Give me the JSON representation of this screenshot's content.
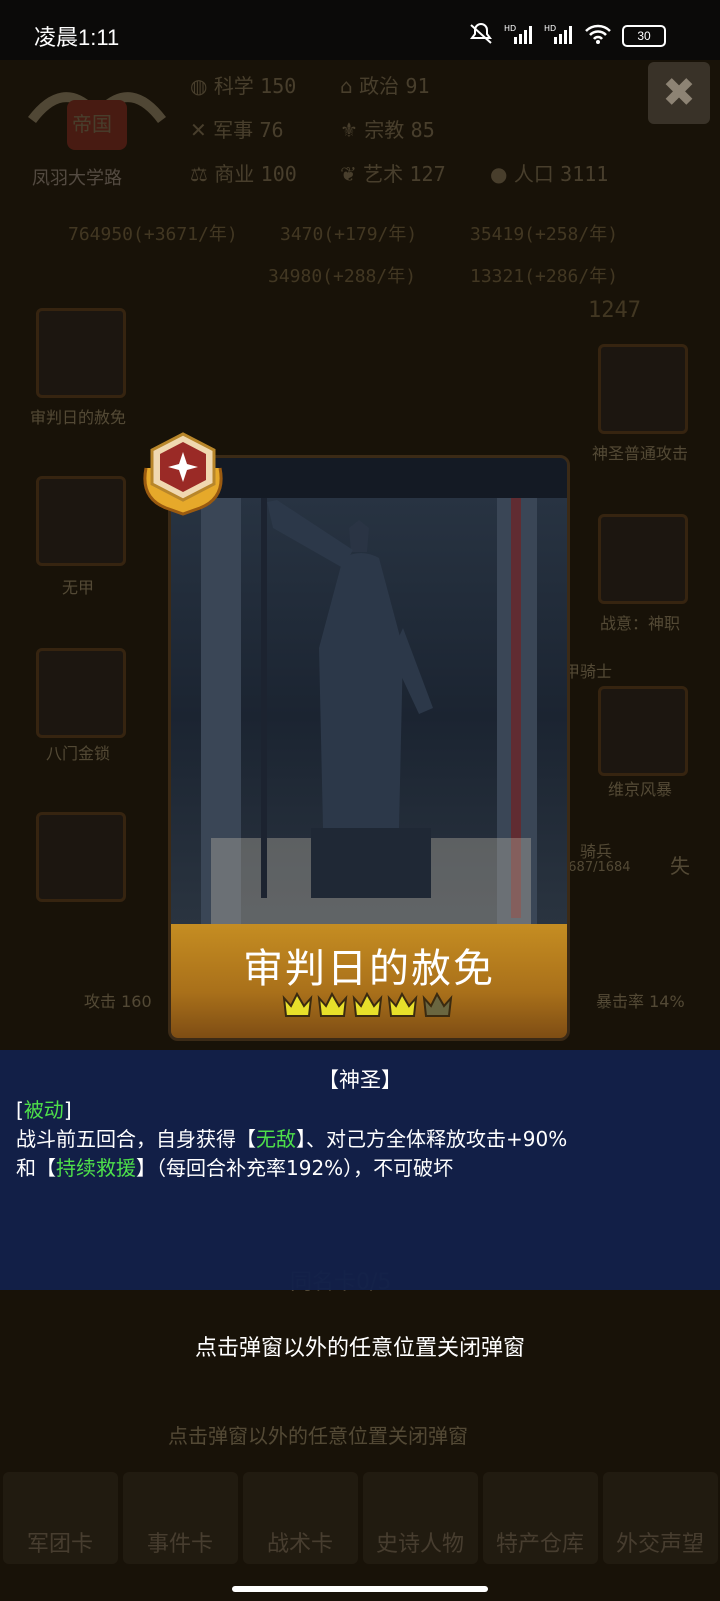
{
  "status_bar": {
    "time": "凌晨1:11",
    "battery": "30",
    "signal_labels": [
      "HD",
      "HD"
    ]
  },
  "top_panel": {
    "faction_title": "帝国",
    "location": "凤羽大学路",
    "stats": [
      {
        "icon": "planet-icon",
        "label": "科学",
        "value": "150"
      },
      {
        "icon": "building-icon",
        "label": "政治",
        "value": "91"
      },
      {
        "icon": "crossed-tools-icon",
        "label": "军事",
        "value": "76"
      },
      {
        "icon": "fleur-icon",
        "label": "宗教",
        "value": "85"
      },
      {
        "icon": "scales-icon",
        "label": "商业",
        "value": "100"
      },
      {
        "icon": "leaf-icon",
        "label": "艺术",
        "value": "127"
      },
      {
        "icon": "person-icon",
        "label": "人口",
        "value": "3111"
      }
    ],
    "resources": [
      "764950(+3671/年)",
      "3470(+179/年)",
      "35419(+258/年)",
      "34980(+288/年)",
      "13321(+286/年)"
    ],
    "medal_count": "1247"
  },
  "background_cards": {
    "left": [
      "审判日的赦免",
      "无甲",
      "八门金锁"
    ],
    "right": [
      "神圣普通攻击",
      "战意：神职",
      "维京风暴"
    ],
    "partial_texts": [
      "甲骑士",
      "骑兵",
      "1687/1684",
      "攻击 160",
      "暴击率 14%",
      "失",
      "同名卡0/5"
    ]
  },
  "card": {
    "name": "审判日的赦免",
    "stars_filled": 4,
    "stars_total": 5
  },
  "description": {
    "category": "【神圣】",
    "passive_tag": "被动",
    "line1_pre": "战斗前五回合，自身获得【",
    "keyword1": "无敌",
    "line1_post": "】、对己方全体释放攻击+90%",
    "line2_pre": "和【",
    "keyword2": "持续救援",
    "line2_post": "】（每回合补充率192%），不可破坏"
  },
  "close_hint": "点击弹窗以外的任意位置关闭弹窗",
  "ghost_hint": "点击弹窗以外的任意位置关闭弹窗",
  "bottom_nav": [
    "军团卡",
    "事件卡",
    "战术卡",
    "史诗人物",
    "特产仓库",
    "外交声望"
  ],
  "colors": {
    "accent_gold": "#c58d22",
    "keyword_green": "#4ee04a",
    "panel_blue": "#12204a"
  }
}
